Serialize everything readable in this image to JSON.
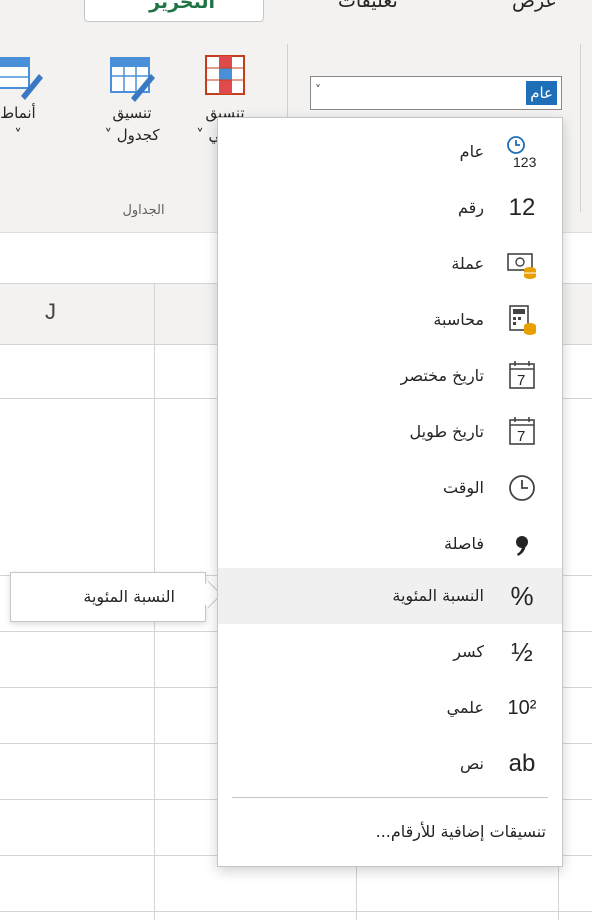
{
  "ribbon": {
    "tab_edit": "التحرير ˅",
    "tab_comments": "تعليقات",
    "tab_view": "عرض",
    "buttons": [
      {
        "label1": "أنماط",
        "label2": "˅"
      },
      {
        "label1": "تنسيق",
        "label2": "كجدول ˅"
      },
      {
        "label1": "تنسيق",
        "label2": "شرطي ˅"
      }
    ],
    "group_label": "الجداول",
    "number_format_value": "عام",
    "combo_arrow": "˅"
  },
  "grid": {
    "column_label": "J"
  },
  "dropdown": {
    "items": [
      {
        "label": "عام",
        "icon": "clock-123-icon",
        "glyph": "123"
      },
      {
        "label": "رقم",
        "icon": "number-12-icon",
        "glyph": "12"
      },
      {
        "label": "عملة",
        "icon": "currency-icon",
        "glyph": ""
      },
      {
        "label": "محاسبة",
        "icon": "accounting-calculator-icon",
        "glyph": ""
      },
      {
        "label": "تاريخ مختصر",
        "icon": "calendar-icon",
        "glyph": "7"
      },
      {
        "label": "تاريخ طويل",
        "icon": "calendar-icon",
        "glyph": "7"
      },
      {
        "label": "الوقت",
        "icon": "clock-icon",
        "glyph": ""
      },
      {
        "label": "فاصلة",
        "icon": "comma-icon",
        "glyph": "❟"
      },
      {
        "label": "النسبة المئوية",
        "icon": "percent-icon",
        "glyph": "%"
      },
      {
        "label": "كسر",
        "icon": "fraction-icon",
        "glyph": "½"
      },
      {
        "label": "علمي",
        "icon": "scientific-icon",
        "glyph": "10²"
      },
      {
        "label": "نص",
        "icon": "text-ab-icon",
        "glyph": "ab"
      }
    ],
    "more_formats": "تنسيقات إضافية للأرقام..."
  },
  "tooltip": {
    "text": "النسبة المئوية"
  },
  "colors": {
    "accent_green": "#217346",
    "selection_blue": "#1f6fb8",
    "currency_orange": "#e8a000",
    "calendar_red": "#c43e1c"
  }
}
